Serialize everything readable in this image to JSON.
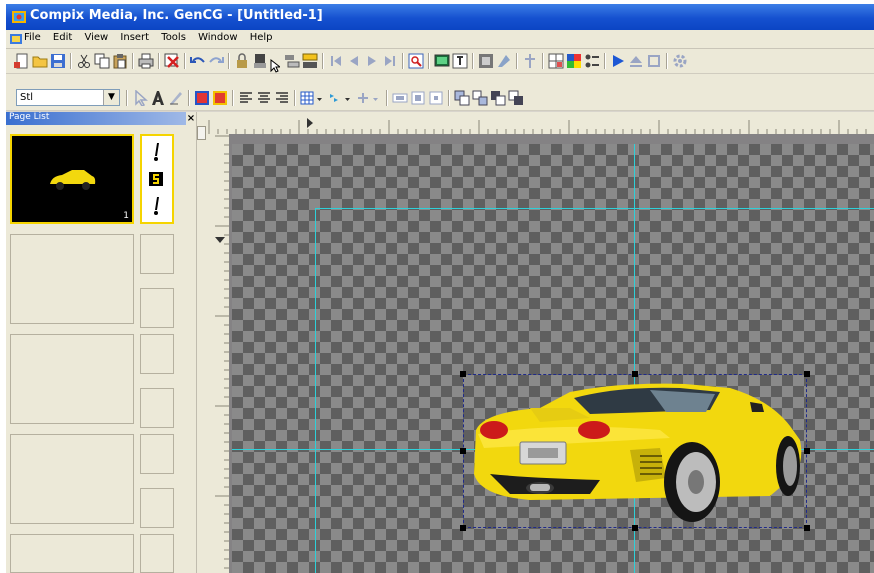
{
  "window": {
    "title": "Compix Media, Inc. GenCG - [Untitled-1]"
  },
  "menu": [
    "File",
    "Edit",
    "View",
    "Insert",
    "Tools",
    "Window",
    "Help"
  ],
  "format_bar": {
    "style_value": "Stl"
  },
  "page_list": {
    "header": "Page List",
    "close_glyph": "×",
    "pages": [
      {
        "number": "1"
      }
    ]
  },
  "colors": {
    "title_bar": "#1550cf",
    "guide": "#2fd0d8",
    "car": "#f2d80e",
    "thumb_border": "#f5d400"
  }
}
